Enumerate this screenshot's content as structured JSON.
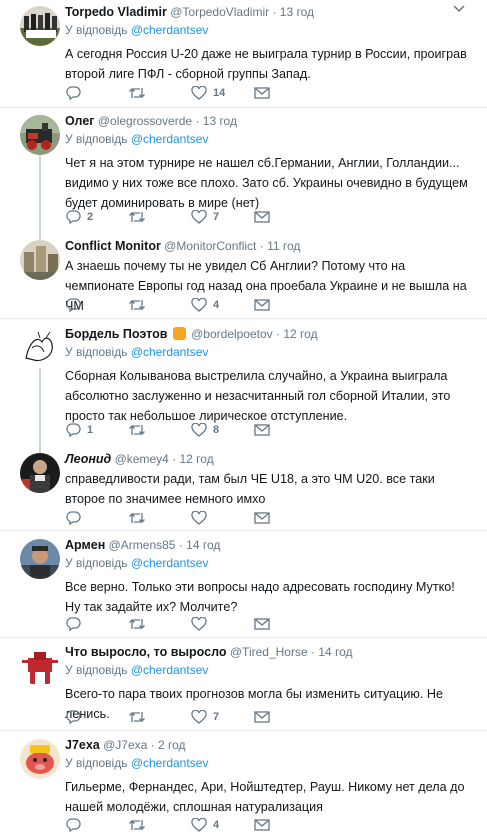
{
  "tweets": [
    {
      "name": "Torpedo Vladimir",
      "handle": "@TorpedoVladimir",
      "time": "13 год",
      "reply_prefix": "У відповідь",
      "reply_to": "@cherdantsev",
      "text": "А сегодня Россия U-20 даже не выиграла турнир в России, проиграв второй лиге ПФЛ - сборной группы Запад.",
      "replies": "",
      "retweets": "",
      "likes": "14"
    },
    {
      "name": "Олег",
      "handle": "@olegrossoverde",
      "time": "13 год",
      "reply_prefix": "У відповідь",
      "reply_to": "@cherdantsev",
      "text": "Чет я на этом турнире не нашел сб.Германии, Англии, Голландии... видимо у них тоже все плохо. Зато сб. Украины очевидно в будущем будет доминировать в мире (нет)",
      "replies": "2",
      "retweets": "",
      "likes": "7"
    },
    {
      "name": "Conflict Monitor",
      "handle": "@MonitorConflict",
      "time": "11 год",
      "reply_prefix": "",
      "reply_to": "",
      "text": "А знаешь почему ты не увидел Сб Англии? Потому что на чемпионате Европы год назад она проебала Украине и не вышла на ЧМ",
      "replies": "",
      "retweets": "",
      "likes": "4"
    },
    {
      "name": "Бордель Поэтов",
      "handle": "@bordelpoetov",
      "time": "12 год",
      "reply_prefix": "У відповідь",
      "reply_to": "@cherdantsev",
      "text": "Сборная Колыванова выстрелила случайно, а Украина выиграла абсолютно заслуженно и незасчитанный гол сборной Италии, это просто так небольшое лирическое отступление.",
      "replies": "1",
      "retweets": "",
      "likes": "8"
    },
    {
      "name": "Леонид",
      "handle": "@kemey4",
      "time": "12 год",
      "reply_prefix": "",
      "reply_to": "",
      "text": "справедливости ради, там был ЧЕ U18, а это ЧМ U20. все таки второе по значимее немного имхо",
      "replies": "",
      "retweets": "",
      "likes": ""
    },
    {
      "name": "Армен",
      "handle": "@Armens85",
      "time": "14 год",
      "reply_prefix": "У відповідь",
      "reply_to": "@cherdantsev",
      "text": "Все верно. Только эти вопросы надо адресовать господину Мутко! Ну так задайте их? Молчите?",
      "replies": "",
      "retweets": "",
      "likes": ""
    },
    {
      "name": "Что выросло, то выросло",
      "handle": "@Tired_Horse",
      "time": "14 год",
      "reply_prefix": "У відповідь",
      "reply_to": "@cherdantsev",
      "text": "Всего-то пара твоих прогнозов могла бы изменить ситуацию. Не ленись.",
      "replies": "",
      "retweets": "",
      "likes": "7"
    },
    {
      "name": "J7exa",
      "handle": "@J7exa",
      "time": "2 год",
      "reply_prefix": "У відповідь",
      "reply_to": "@cherdantsev",
      "text": "Гильерме, Фернандес, Ари, Нойштедтер, Рауш. Никому нет дела до нашей молодёжи, сплошная натурализация",
      "replies": "",
      "retweets": "",
      "likes": "4"
    }
  ],
  "separator": "·",
  "colors": {
    "link": "#1b95e0",
    "muted": "#657786",
    "text": "#14171a",
    "border": "#e6ecf0",
    "thread": "#ccd6dd"
  },
  "icons": {
    "reply": "reply-icon",
    "retweet": "retweet-icon",
    "like": "heart-icon",
    "dm": "envelope-icon",
    "menu": "chevron-down-icon"
  }
}
